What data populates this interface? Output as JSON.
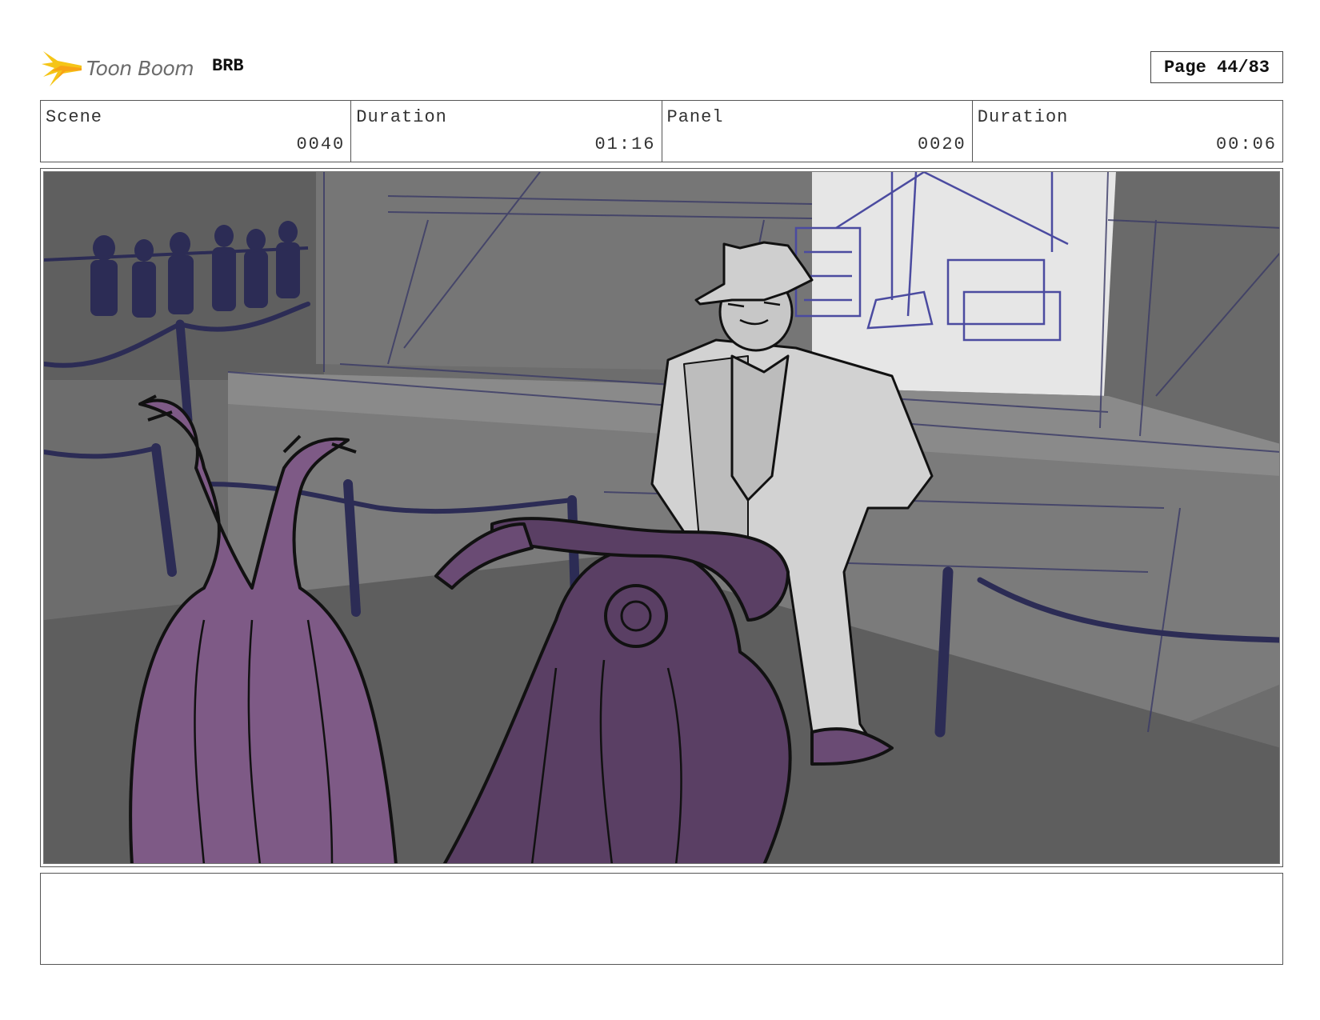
{
  "header": {
    "brand": "Toon Boom",
    "project": "BRB",
    "page": "Page 44/83"
  },
  "info": {
    "scene_label": "Scene",
    "scene_value": "0040",
    "scene_duration_label": "Duration",
    "scene_duration_value": "01:16",
    "panel_label": "Panel",
    "panel_value": "0020",
    "panel_duration_label": "Duration",
    "panel_duration_value": "00:06"
  },
  "notes": {
    "text": ""
  },
  "colors": {
    "logo_yellow": "#f5c518",
    "character_purple": "#7e5a86",
    "character_dark_purple": "#5a3f64",
    "layout_blue": "#2c2c55"
  }
}
